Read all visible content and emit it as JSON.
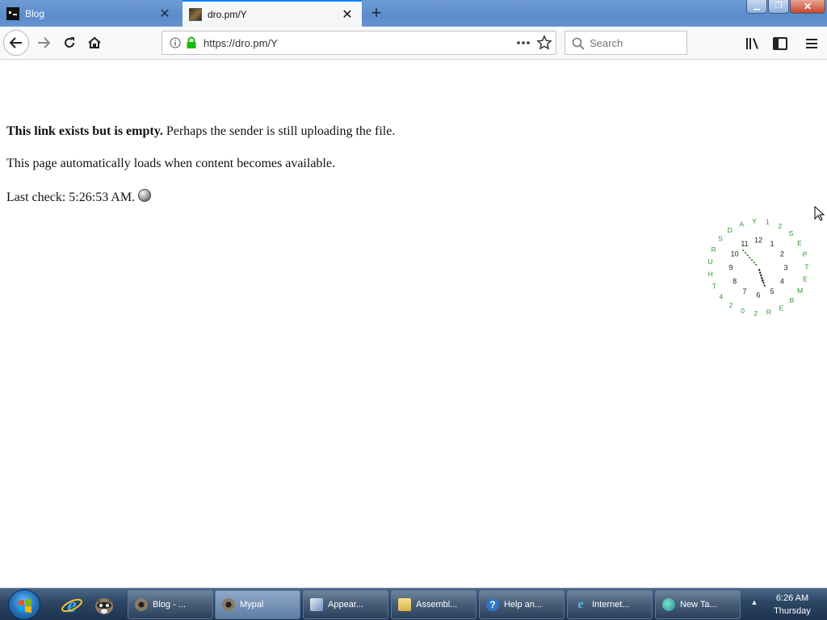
{
  "browser": {
    "tabs": [
      {
        "label": "Blog",
        "favicon": "terminal-icon"
      },
      {
        "label": "dro.pm/Y",
        "favicon": "dro-pm-icon"
      }
    ],
    "url": "https://dro.pm/Y",
    "search_placeholder": "Search",
    "accent_color": "#0a84ff"
  },
  "page": {
    "message_bold": "This link exists but is empty.",
    "message_rest": " Perhaps the sender is still uploading the file.",
    "autoload": "This page automatically loads when content becomes available.",
    "last_check": "Last check: 5:26:53 AM."
  },
  "clock_widget": {
    "hour_numbers": [
      "12",
      "1",
      "2",
      "3",
      "4",
      "5",
      "6",
      "7",
      "8",
      "9",
      "10",
      "11"
    ],
    "date_ring": [
      "1",
      "2",
      "S",
      "E",
      "P",
      "T",
      "E",
      "M",
      "B",
      "E",
      "R",
      "2",
      "0",
      "2",
      "4",
      "T",
      "H",
      "U",
      "R",
      "S",
      "D",
      "A",
      "Y"
    ],
    "time": {
      "hours": 5,
      "minutes": 26,
      "seconds": 53
    },
    "ring_color": "#2a9a2a",
    "number_color": "#222222"
  },
  "taskbar": {
    "items": [
      {
        "label": "Blog - ...",
        "icon": "raccoon-icon"
      },
      {
        "label": "Mypal",
        "icon": "raccoon-icon"
      },
      {
        "label": "Appear...",
        "icon": "paint-icon"
      },
      {
        "label": "Assembl...",
        "icon": "folder-icon"
      },
      {
        "label": "Help an...",
        "icon": "help-icon"
      },
      {
        "label": "Internet...",
        "icon": "ie-icon"
      },
      {
        "label": "New Ta...",
        "icon": "ie-edge-icon"
      }
    ],
    "clock_time": "6:26 AM",
    "clock_day": "Thursday"
  }
}
